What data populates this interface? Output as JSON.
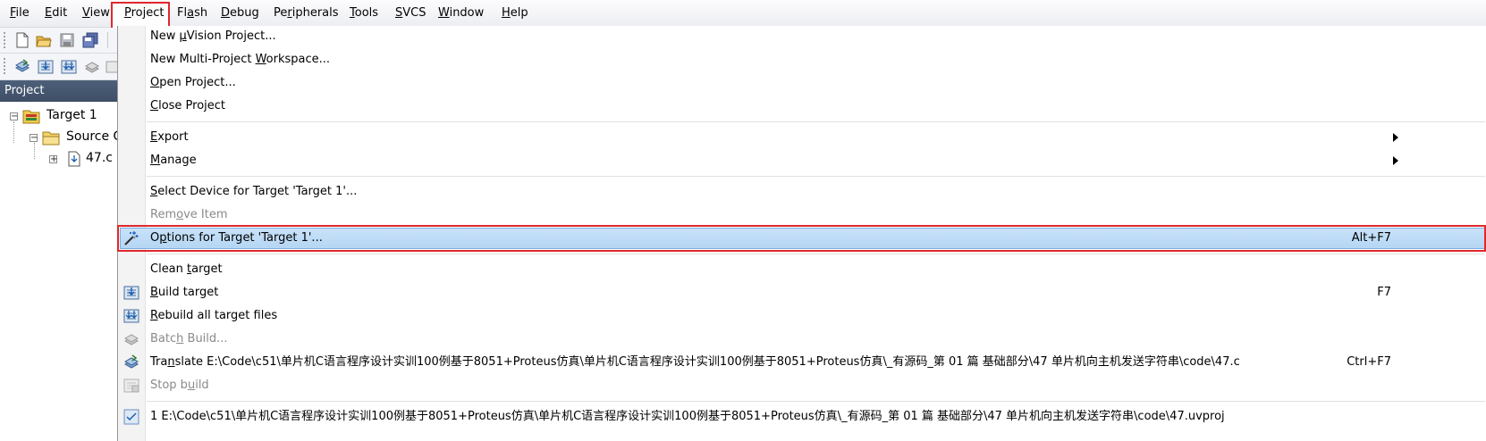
{
  "menubar": {
    "items": [
      {
        "pre": "",
        "key": "F",
        "post": "ile"
      },
      {
        "pre": "",
        "key": "E",
        "post": "dit"
      },
      {
        "pre": "",
        "key": "V",
        "post": "iew"
      },
      {
        "pre": "",
        "key": "P",
        "post": "roject"
      },
      {
        "pre": "Fl",
        "key": "a",
        "post": "sh"
      },
      {
        "pre": "",
        "key": "D",
        "post": "ebug"
      },
      {
        "pre": "Pe",
        "key": "r",
        "post": "ipherals"
      },
      {
        "pre": "",
        "key": "T",
        "post": "ools"
      },
      {
        "pre": "",
        "key": "S",
        "post": "VCS"
      },
      {
        "pre": "",
        "key": "W",
        "post": "indow"
      },
      {
        "pre": "",
        "key": "H",
        "post": "elp"
      }
    ]
  },
  "project_pane": {
    "title": "Project",
    "target": "Target 1",
    "group": "Source G",
    "file": "47.c"
  },
  "menu": {
    "new_project": {
      "pre": "New ",
      "key": "µ",
      "post": "Vision Project..."
    },
    "new_multi": {
      "pre": "New Multi-Project ",
      "key": "W",
      "post": "orkspace..."
    },
    "open_project": {
      "pre": "",
      "key": "O",
      "post": "pen Project..."
    },
    "close_project": {
      "pre": "",
      "key": "C",
      "post": "lose Project"
    },
    "export": {
      "pre": "",
      "key": "E",
      "post": "xport"
    },
    "manage": {
      "pre": "",
      "key": "M",
      "post": "anage"
    },
    "select_device": {
      "pre": "",
      "key": "S",
      "post": "elect Device for Target 'Target 1'..."
    },
    "remove_item": {
      "pre": "Rem",
      "key": "o",
      "post": "ve Item"
    },
    "options": {
      "pre": "O",
      "key": "p",
      "post": "tions for Target 'Target 1'...",
      "shortcut": "Alt+F7"
    },
    "clean_target": {
      "pre": "Clean ",
      "key": "t",
      "post": "arget"
    },
    "build_target": {
      "pre": "",
      "key": "B",
      "post": "uild target",
      "shortcut": "F7"
    },
    "rebuild_all": {
      "pre": "",
      "key": "R",
      "post": "ebuild all target files"
    },
    "batch_build": {
      "pre": "Batc",
      "key": "h",
      "post": " Build..."
    },
    "translate": {
      "pre": "Tra",
      "key": "n",
      "post": "slate E:\\Code\\c51\\单片机C语言程序设计实训100例基于8051+Proteus仿真\\单片机C语言程序设计实训100例基于8051+Proteus仿真\\_有源码_第 01 篇 基础部分\\47 单片机向主机发送字符串\\code\\47.c",
      "shortcut": "Ctrl+F7"
    },
    "stop_build": {
      "pre": "Stop b",
      "key": "u",
      "post": "ild"
    },
    "recent": {
      "text": "1 E:\\Code\\c51\\单片机C语言程序设计实训100例基于8051+Proteus仿真\\单片机C语言程序设计实训100例基于8051+Proteus仿真\\_有源码_第 01 篇 基础部分\\47 单片机向主机发送字符串\\code\\47.uvproj"
    }
  },
  "colors": {
    "highlight_red": "#e0282c",
    "selected_bg": "#b5d6f3",
    "pane_header": "#44566f"
  }
}
